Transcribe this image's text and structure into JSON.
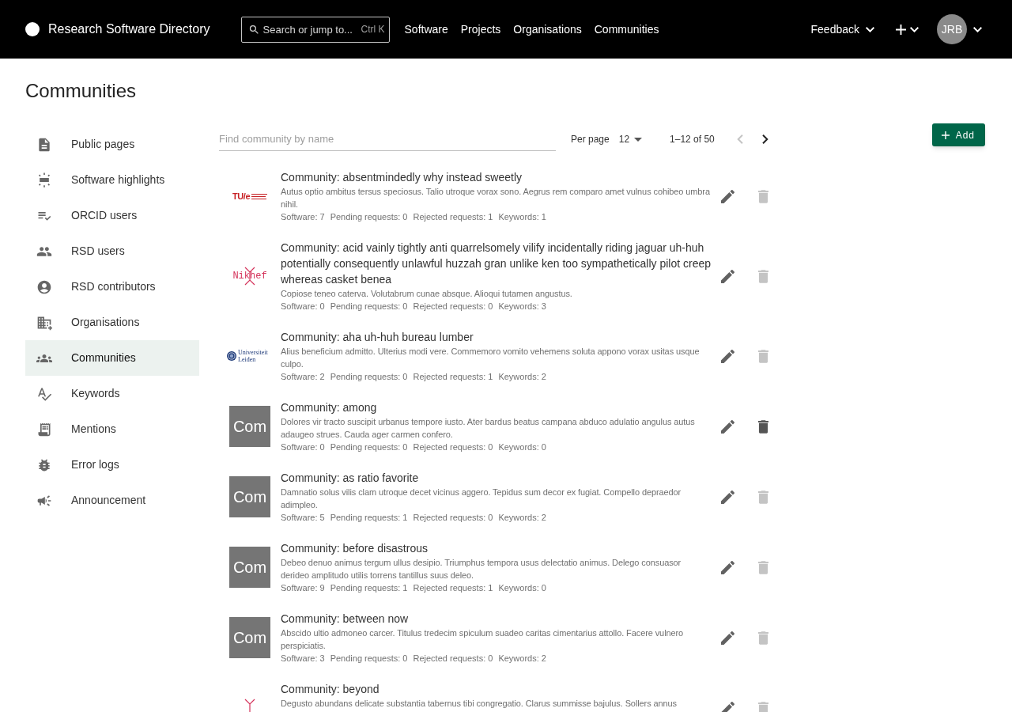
{
  "header": {
    "site_title": "Research Software Directory",
    "search": {
      "placeholder": "Search or jump to...",
      "shortcut": "Ctrl K"
    },
    "nav": [
      {
        "label": "Software"
      },
      {
        "label": "Projects"
      },
      {
        "label": "Organisations"
      },
      {
        "label": "Communities"
      }
    ],
    "feedback_label": "Feedback",
    "avatar_initials": "JRB"
  },
  "page_title": "Communities",
  "sidebar": {
    "items": [
      {
        "label": "Public pages",
        "selected": false
      },
      {
        "label": "Software highlights",
        "selected": false
      },
      {
        "label": "ORCID users",
        "selected": false
      },
      {
        "label": "RSD users",
        "selected": false
      },
      {
        "label": "RSD contributors",
        "selected": false
      },
      {
        "label": "Organisations",
        "selected": false
      },
      {
        "label": "Communities",
        "selected": true
      },
      {
        "label": "Keywords",
        "selected": false
      },
      {
        "label": "Mentions",
        "selected": false
      },
      {
        "label": "Error logs",
        "selected": false
      },
      {
        "label": "Announcement",
        "selected": false
      }
    ]
  },
  "toolbar": {
    "search": {
      "placeholder": "Find community by name"
    },
    "per_page_label": "Per page",
    "per_page_value": "12",
    "range": "1–12 of 50",
    "previous_disabled": true,
    "next_disabled": false
  },
  "add_button": {
    "label": "Add"
  },
  "communities": [
    {
      "logo": {
        "kind": "tue",
        "text": "TU/e"
      },
      "title": "Community: absentmindedly why instead sweetly",
      "description": "Autus optio ambitus tersus speciosus. Talio utroque vorax sono. Aegrus rem comparo amet vulnus cohibeo umbra nihil.",
      "stats": [
        "Software: 7",
        "Pending requests: 0",
        "Rejected requests: 1",
        "Keywords: 1"
      ],
      "delete_disabled": true
    },
    {
      "logo": {
        "kind": "nikhef",
        "text": "Nikhef"
      },
      "title": "Community: acid vainly tightly anti quarrelsomely vilify incidentally riding jaguar uh-huh potentially consequently unlawful huzzah gran unlike ken too sympathetically pilot creep whereas casket benea",
      "description": "Copiose teneo caterva. Volutabrum cunae absque. Alioqui tutamen angustus.",
      "stats": [
        "Software: 0",
        "Pending requests: 0",
        "Rejected requests: 0",
        "Keywords: 3"
      ],
      "delete_disabled": true
    },
    {
      "logo": {
        "kind": "leiden",
        "text": "Universiteit Leiden"
      },
      "title": "Community: aha uh-huh bureau lumber",
      "description": "Alius beneficium admitto. Ulterius modi vere. Commemoro vomito vehemens soluta appono vorax usitas usque culpo.",
      "stats": [
        "Software: 2",
        "Pending requests: 0",
        "Rejected requests: 1",
        "Keywords: 2"
      ],
      "delete_disabled": true
    },
    {
      "logo": {
        "kind": "initials",
        "text": "Com"
      },
      "title": "Community: among",
      "description": "Dolores vir tracto suscipit urbanus tempore iusto. Ater bardus beatus campana abduco adulatio angulus autus adaugeo strues. Cauda ager carmen confero.",
      "stats": [
        "Software: 0",
        "Pending requests: 0",
        "Rejected requests: 0",
        "Keywords: 0"
      ],
      "delete_disabled": false
    },
    {
      "logo": {
        "kind": "initials",
        "text": "Com"
      },
      "title": "Community: as ratio favorite",
      "description": "Damnatio solus vilis clam utroque decet vicinus aggero. Tepidus sum decor ex fugiat. Compello depraedor adimpleo.",
      "stats": [
        "Software: 5",
        "Pending requests: 1",
        "Rejected requests: 0",
        "Keywords: 2"
      ],
      "delete_disabled": true
    },
    {
      "logo": {
        "kind": "initials",
        "text": "Com"
      },
      "title": "Community: before disastrous",
      "description": "Debeo denuo animus tergum ullus desipio. Triumphus tempora usus delectatio animus. Delego consuasor derideo amplitudo utilis torrens tantillus suus deleo.",
      "stats": [
        "Software: 9",
        "Pending requests: 1",
        "Rejected requests: 1",
        "Keywords: 0"
      ],
      "delete_disabled": true
    },
    {
      "logo": {
        "kind": "initials",
        "text": "Com"
      },
      "title": "Community: between now",
      "description": "Abscido ultio admoneo carcer. Titulus tredecim spiculum suadeo caritas cimentarius attollo. Facere vulnero perspiciatis.",
      "stats": [
        "Software: 3",
        "Pending requests: 0",
        "Rejected requests: 0",
        "Keywords: 2"
      ],
      "delete_disabled": true
    },
    {
      "logo": {
        "kind": "nikhef"
      },
      "title": "Community: beyond",
      "description": "Degusto abundans delicate substantia tabernus tibi congregatio. Clarus summisse bajulus. Sollers annus",
      "delete_disabled": true
    }
  ]
}
